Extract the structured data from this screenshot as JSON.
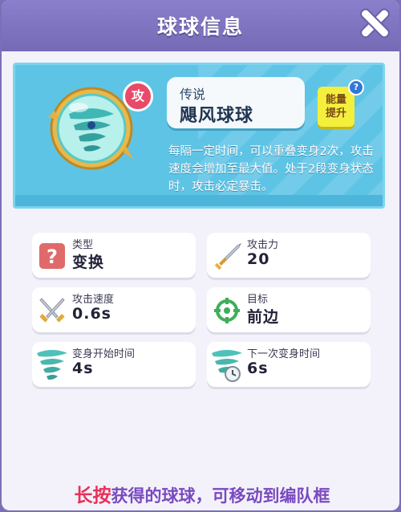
{
  "window": {
    "title": "球球信息"
  },
  "ball": {
    "rarity": "传说",
    "name": "飓风球球",
    "badge": "攻",
    "energy_line1": "能量",
    "energy_line2": "提升",
    "help": "?",
    "description": "每隔一定时间，可以重叠变身2次，攻击速度会增加至最大值。处于2段变身状态时，攻击必定暴击。"
  },
  "stats": {
    "type_label": "类型",
    "type_value": "变换",
    "attack_label": "攻击力",
    "attack_value": "20",
    "speed_label": "攻击速度",
    "speed_value": "0.6s",
    "target_label": "目标",
    "target_value": "前边",
    "transform_start_label": "变身开始时间",
    "transform_start_value": "4s",
    "next_transform_label": "下一次变身时间",
    "next_transform_value": "6s"
  },
  "footer": {
    "highlight": "长按",
    "text": "获得的球球，可移动到编队框"
  },
  "colors": {
    "titlebar": "#7b6fb8",
    "panel": "#5ec4e6",
    "badge": "#e84a6a",
    "footer_highlight": "#e8305a",
    "footer_text": "#7a4ac0"
  }
}
